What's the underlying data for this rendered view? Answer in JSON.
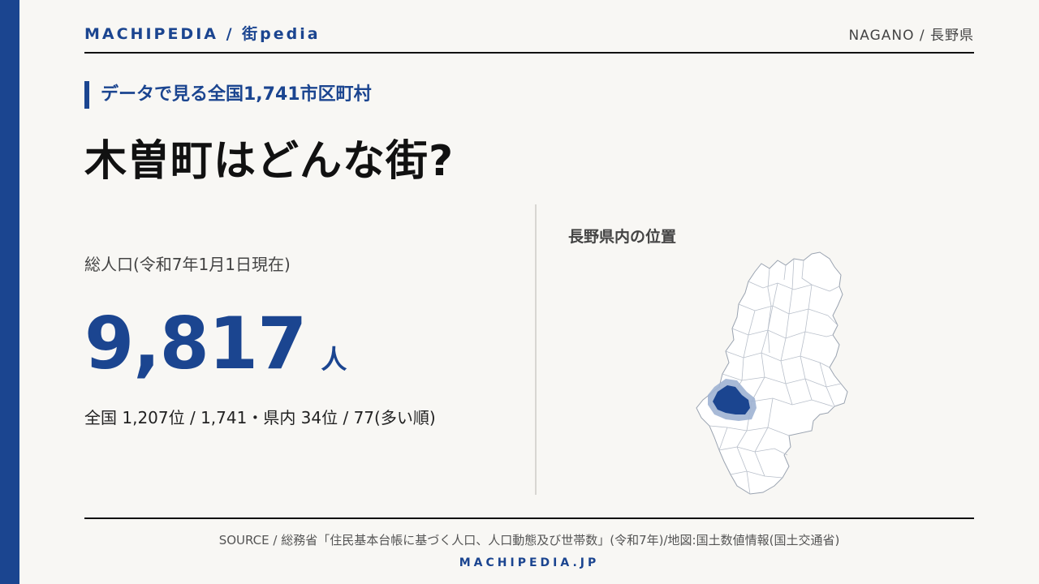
{
  "header": {
    "brand": "MACHIPEDIA / 街pedia",
    "prefecture": "NAGANO / 長野県"
  },
  "kicker": "データで見る全国1,741市区町村",
  "title": "木曽町はどんな街?",
  "stat": {
    "label": "総人口(令和7年1月1日現在)",
    "value": "9,817",
    "unit": "人",
    "rank": "全国 1,207位 / 1,741・県内 34位 / 77(多い順)"
  },
  "map": {
    "title": "長野県内の位置",
    "highlight_color": "#1b4590",
    "halo_color": "#9fb2d3"
  },
  "footer": {
    "source": "SOURCE / 総務省「住民基本台帳に基づく人口、人口動態及び世帯数」(令和7年)/地図:国土数値情報(国土交通省)",
    "site": "MACHIPEDIA.JP"
  },
  "colors": {
    "accent": "#1b4590",
    "background": "#f8f7f4"
  }
}
